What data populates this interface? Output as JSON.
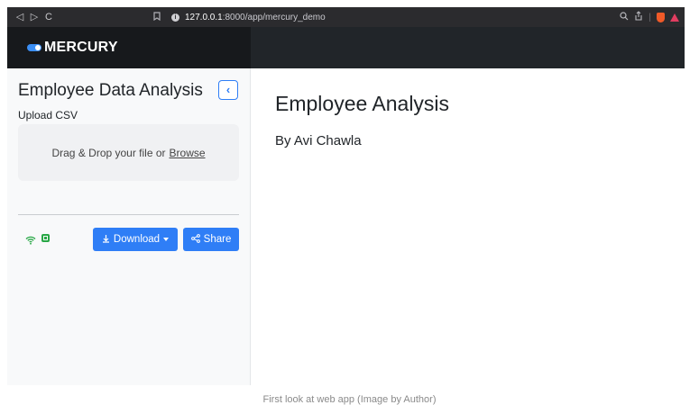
{
  "browser": {
    "nav": {
      "back": "◁",
      "forward": "▷",
      "reload": "C"
    },
    "bookmark_icon": "bookmark-icon",
    "url_host": "127.0.0.1",
    "url_rest": ":8000/app/mercury_demo",
    "right_icons": [
      "zoom-icon",
      "share-icon",
      "brave-shield-icon",
      "rewards-icon"
    ]
  },
  "app": {
    "brand": "MERCURY",
    "sidebar": {
      "title": "Employee Data Analysis",
      "collapse_icon": "chevron-left-icon",
      "upload_label": "Upload CSV",
      "dropzone_text": "Drag & Drop your file or",
      "dropzone_link": "Browse",
      "download_label": "Download",
      "share_label": "Share",
      "status_icons": [
        "wifi-icon",
        "chip-icon"
      ]
    },
    "main": {
      "title": "Employee Analysis",
      "author": "By Avi Chawla"
    }
  },
  "caption": "First look at web app (Image by Author)",
  "colors": {
    "accent": "#2f7ef6",
    "topbar": "#212529",
    "status_green": "#28a745",
    "sidebar_bg": "#f8f9fa"
  }
}
